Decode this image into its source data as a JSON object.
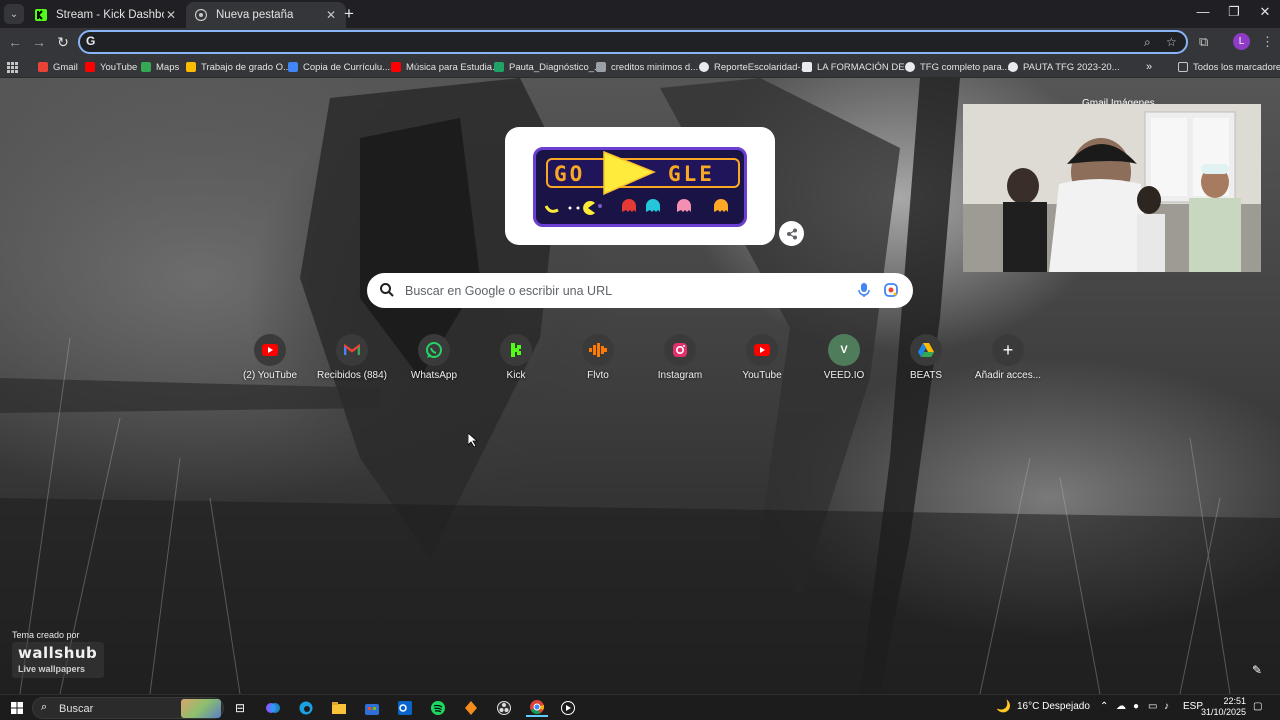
{
  "tabs": [
    {
      "title": "Stream - Kick Dashboard",
      "active": false
    },
    {
      "title": "Nueva pestaña",
      "active": true
    }
  ],
  "omnibox": {
    "value": "",
    "placeholder": ""
  },
  "bookmarks": [
    {
      "label": "Gmail",
      "color": "#ea4335"
    },
    {
      "label": "YouTube",
      "color": "#ff0000"
    },
    {
      "label": "Maps",
      "color": "#34a853"
    },
    {
      "label": "Trabajo de grado O...",
      "color": "#fbbc04"
    },
    {
      "label": "Copia de Currículu...",
      "color": "#4285f4"
    },
    {
      "label": "Música para Estudia...",
      "color": "#ff0000"
    },
    {
      "label": "Pauta_Diagnóstico_...",
      "color": "#21a366"
    },
    {
      "label": "creditos minimos d...",
      "color": "#9aa0a6"
    },
    {
      "label": "ReporteEscolaridad-...",
      "color": "#e8eaed"
    },
    {
      "label": "LA FORMACIÓN DE...",
      "color": "#e8eaed"
    },
    {
      "label": "TFG completo para...",
      "color": "#e8eaed"
    },
    {
      "label": "PAUTA TFG 2023-20...",
      "color": "#e8eaed"
    }
  ],
  "all_bookmarks_label": "Todos los marcadores",
  "top_links": "Gmail   Imágenes",
  "search": {
    "placeholder": "Buscar en Google o escribir una URL"
  },
  "shortcuts": [
    {
      "label": "(2) YouTube",
      "icon": "youtube-icon",
      "color": "#ff0000"
    },
    {
      "label": "Recibidos (884)",
      "icon": "gmail-icon",
      "color": "#ea4335"
    },
    {
      "label": "WhatsApp",
      "icon": "whatsapp-icon",
      "color": "#25d366"
    },
    {
      "label": "Kick",
      "icon": "kick-icon",
      "color": "#53fc18"
    },
    {
      "label": "Flvto",
      "icon": "flvto-icon",
      "color": "#ff7a00"
    },
    {
      "label": "Instagram",
      "icon": "instagram-icon",
      "color": "#e1306c"
    },
    {
      "label": "YouTube",
      "icon": "youtube-icon",
      "color": "#ff0000"
    },
    {
      "label": "VEED.IO",
      "icon": "veed-icon",
      "color": "#4f7d5c"
    },
    {
      "label": "BEATS",
      "icon": "drive-icon",
      "color": "#1e88e5"
    },
    {
      "label": "Añadir acces...",
      "icon": "plus-icon",
      "color": "#ffffff"
    }
  ],
  "theme": {
    "credit": "Tema creado por",
    "brand": "wallshub",
    "tagline": "Live wallpapers"
  },
  "taskbar": {
    "search_label": "Buscar",
    "weather": "16°C  Despejado",
    "language": "ESP",
    "time": "22:51",
    "date": "31/10/2025"
  },
  "doodle": {
    "left": "GO",
    "right": "GLE"
  },
  "profile_initial": "L"
}
